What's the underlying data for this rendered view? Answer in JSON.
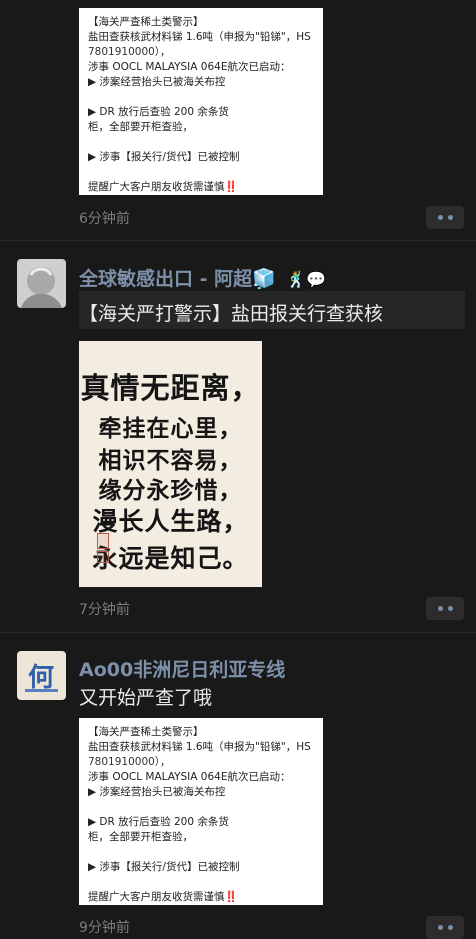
{
  "posts": [
    {
      "id": "p1",
      "image_card": {
        "lines": [
          "【海关严查稀土类警示】",
          "盐田查获核武材料锑 1.6吨（申报为\"铅锑\"，HS",
          "7801910000），",
          "涉事 OOCL MALAYSIA 064E航次已启动：",
          "▶ 涉案经营抬头已被海关布控",
          "",
          "▶ DR 放行后查验 200 余条货",
          "柜，全部要开柜查验，",
          "",
          "▶ 涉事【报关行/货代】已被控制",
          "",
          "提醒广大客户朋友收货需谨慎"
        ],
        "emphasis": "‼️"
      },
      "time": "6分钟前"
    },
    {
      "id": "p2",
      "author": "全球敏感出口 - 阿超🧊",
      "author_emoji": "🕺💬",
      "text": "【海关严打警示】盐田报关行查获核",
      "calligraphy": {
        "lines": [
          "真情无距离，",
          "牵挂在心里，",
          "相识不容易，",
          "缘分永珍惜，",
          "漫长人生路，",
          "永远是知己。"
        ]
      },
      "time": "7分钟前"
    },
    {
      "id": "p3",
      "author": "Ao00非洲尼日利亚专线",
      "avatar_text": "何",
      "text": "又开始严查了哦",
      "image_card": {
        "lines": [
          "【海关严查稀土类警示】",
          "盐田查获核武材料锑 1.6吨（申报为\"铅锑\"，HS",
          "7801910000），",
          "涉事 OOCL MALAYSIA 064E航次已启动：",
          "▶ 涉案经营抬头已被海关布控",
          "",
          "▶ DR 放行后查验 200 余条货",
          "柜，全部要开柜查验，",
          "",
          "▶ 涉事【报关行/货代】已被控制",
          "",
          "提醒广大客户朋友收货需谨慎"
        ],
        "emphasis": "‼️"
      },
      "time": "9分钟前"
    }
  ],
  "colors": {
    "background": "#191919",
    "name": "#7d90a9",
    "text": "#ebebeb",
    "time": "#7c7c7c"
  }
}
